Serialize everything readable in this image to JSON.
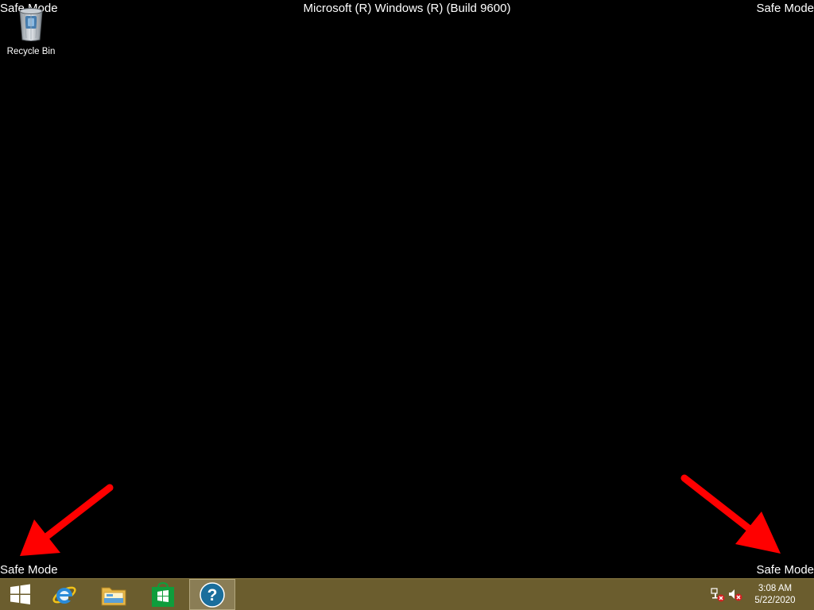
{
  "overlay": {
    "safe_mode_label": "Safe Mode",
    "build_label": "Microsoft (R) Windows (R) (Build 9600)"
  },
  "desktop": {
    "icons": [
      {
        "label": "Recycle Bin",
        "icon": "recycle-bin-icon"
      }
    ]
  },
  "taskbar": {
    "start_icon": "windows-logo-icon",
    "pinned": [
      {
        "name": "Internet Explorer",
        "icon": "ie-icon"
      },
      {
        "name": "File Explorer",
        "icon": "folder-icon"
      },
      {
        "name": "Store",
        "icon": "store-icon"
      },
      {
        "name": "Help and Support",
        "icon": "help-icon",
        "active": true
      }
    ],
    "tray": {
      "network_icon": "network-disconnected-icon",
      "volume_icon": "volume-muted-icon",
      "time": "3:08 AM",
      "date": "5/22/2020"
    },
    "color": "#6b5d2e"
  },
  "annotations": {
    "arrow_color": "#ff0000"
  }
}
